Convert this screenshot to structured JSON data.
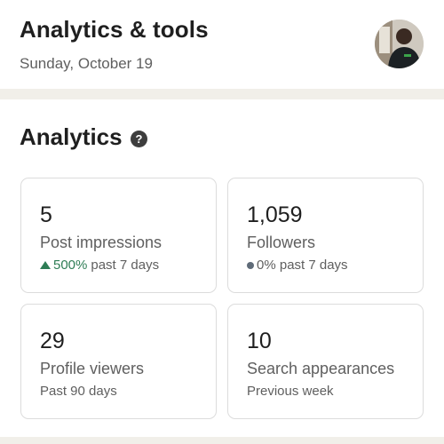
{
  "header": {
    "title": "Analytics & tools",
    "date": "Sunday, October 19"
  },
  "analytics": {
    "title": "Analytics",
    "help_glyph": "?",
    "cards": [
      {
        "value": "5",
        "label": "Post impressions",
        "trend_icon": "triangle-up-icon",
        "trend_value": "500%",
        "trend_text": "past 7 days",
        "trend_color": "#2e7d55"
      },
      {
        "value": "1,059",
        "label": "Followers",
        "trend_icon": "dot-icon",
        "trend_text": "0% past 7 days"
      },
      {
        "value": "29",
        "label": "Profile viewers",
        "sub": "Past 90 days"
      },
      {
        "value": "10",
        "label": "Search appearances",
        "sub": "Previous week"
      }
    ]
  }
}
